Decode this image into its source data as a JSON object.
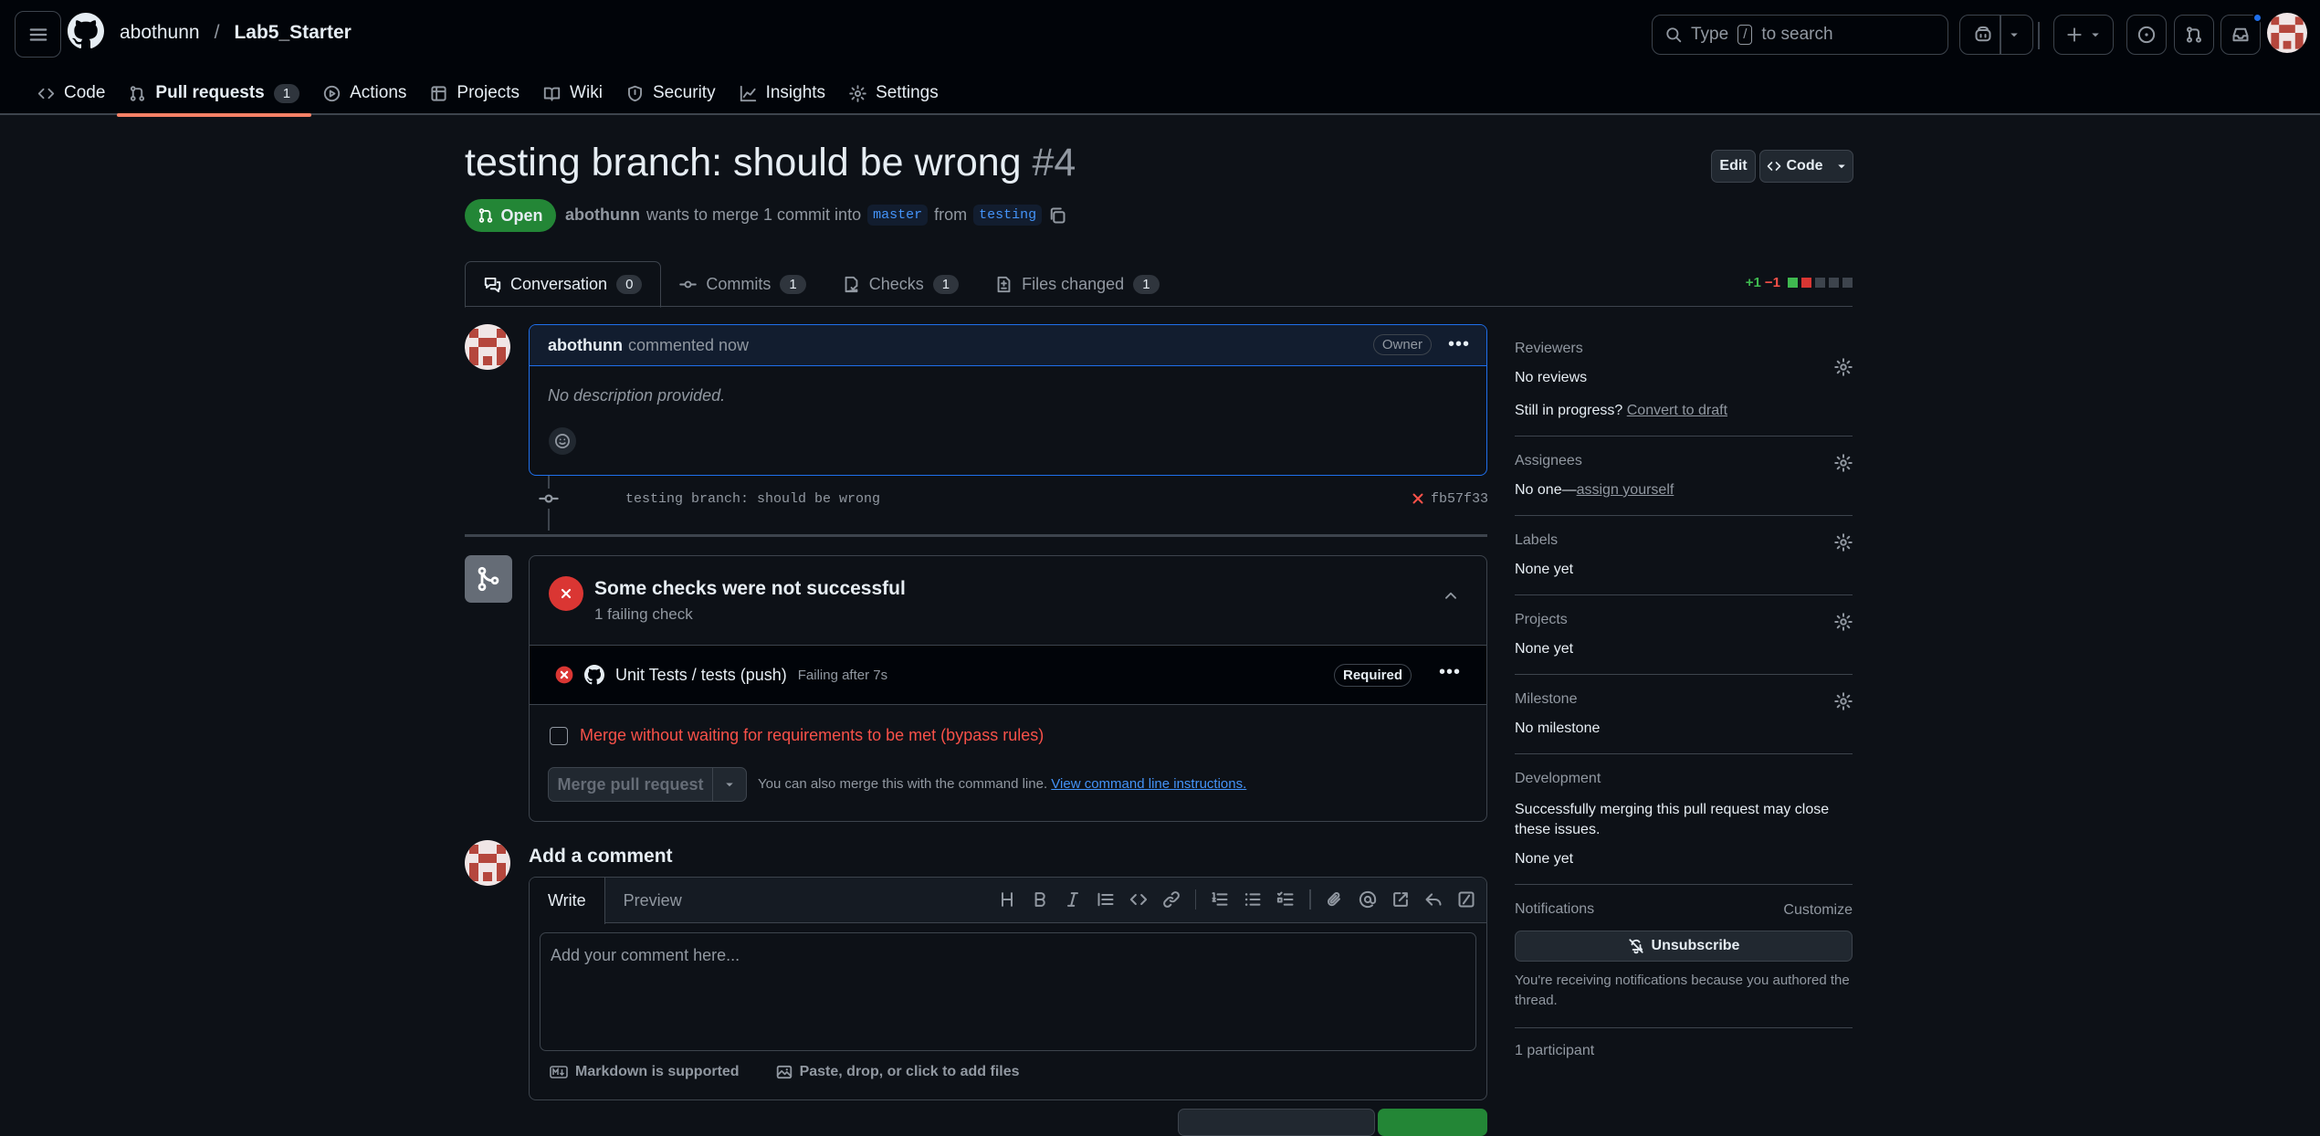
{
  "header": {
    "owner": "abothunn",
    "separator": "/",
    "repo": "Lab5_Starter",
    "search_before": "Type",
    "search_key": "/",
    "search_after": "to search"
  },
  "repo_nav": [
    {
      "label": "Code",
      "icon": "code-icon"
    },
    {
      "label": "Pull requests",
      "icon": "pull-request-icon",
      "count": "1"
    },
    {
      "label": "Actions",
      "icon": "play-icon"
    },
    {
      "label": "Projects",
      "icon": "table-icon"
    },
    {
      "label": "Wiki",
      "icon": "book-icon"
    },
    {
      "label": "Security",
      "icon": "shield-icon"
    },
    {
      "label": "Insights",
      "icon": "graph-icon"
    },
    {
      "label": "Settings",
      "icon": "gear-icon"
    }
  ],
  "pr": {
    "title": "testing branch: should be wrong",
    "number": "#4",
    "edit_label": "Edit",
    "code_label": "Code",
    "state": "Open",
    "author": "abothunn",
    "meta_mid": "wants to merge 1 commit into",
    "base": "master",
    "meta_from": "from",
    "head": "testing"
  },
  "pr_tabs": [
    {
      "label": "Conversation",
      "count": "0",
      "icon": "comment-discussion-icon"
    },
    {
      "label": "Commits",
      "count": "1",
      "icon": "commit-icon"
    },
    {
      "label": "Checks",
      "count": "1",
      "icon": "checklist-icon"
    },
    {
      "label": "Files changed",
      "count": "1",
      "icon": "file-diff-icon"
    }
  ],
  "diffstat": {
    "additions": "+1",
    "deletions": "−1"
  },
  "comment": {
    "author": "abothunn",
    "time": "commented now",
    "badge": "Owner",
    "body": "No description provided."
  },
  "commit": {
    "message": "testing branch: should be wrong",
    "sha": "fb57f33"
  },
  "checks": {
    "title": "Some checks were not successful",
    "subtitle": "1 failing check",
    "name": "Unit Tests / tests (push)",
    "status": "Failing after 7s",
    "required": "Required",
    "bypass_label": "Merge without waiting for requirements to be met (bypass rules)",
    "merge_button": "Merge pull request",
    "hint_text": "You can also merge this with the command line.",
    "hint_link": "View command line instructions."
  },
  "add_comment": {
    "title": "Add a comment",
    "write_tab": "Write",
    "preview_tab": "Preview",
    "placeholder": "Add your comment here...",
    "markdown_note": "Markdown is supported",
    "attach_note": "Paste, drop, or click to add files"
  },
  "sidebar": {
    "reviewers_title": "Reviewers",
    "reviewers_value": "No reviews",
    "draft_prefix": "Still in progress?",
    "draft_link": "Convert to draft",
    "assignees_title": "Assignees",
    "assignees_prefix": "No one—",
    "assignees_link": "assign yourself",
    "labels_title": "Labels",
    "labels_value": "None yet",
    "projects_title": "Projects",
    "projects_value": "None yet",
    "milestone_title": "Milestone",
    "milestone_value": "No milestone",
    "development_title": "Development",
    "development_desc": "Successfully merging this pull request may close these issues.",
    "development_value": "None yet",
    "notifications_title": "Notifications",
    "customize": "Customize",
    "unsubscribe": "Unsubscribe",
    "notif_reason": "You're receiving notifications because you authored the thread.",
    "participants": "1 participant"
  },
  "colors": {
    "accent_open": "#238636",
    "danger": "#da3633",
    "link": "#4493f8",
    "tab_underline": "#f78166"
  }
}
